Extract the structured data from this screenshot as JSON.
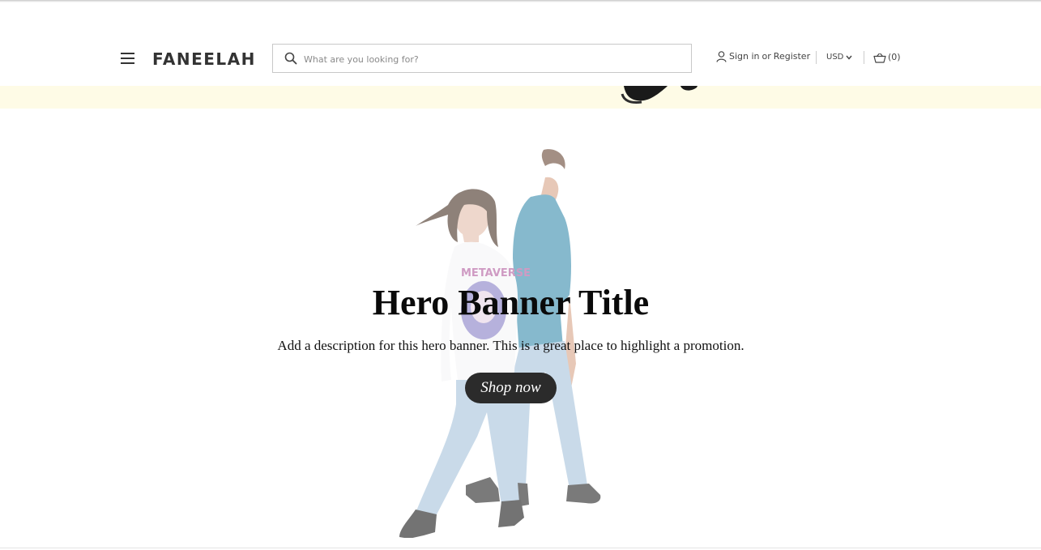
{
  "header": {
    "brand": "FANEELAH",
    "search": {
      "placeholder": "What are you looking for?",
      "value": ""
    },
    "account": {
      "sign_in": "Sign in",
      "or": "or",
      "register": "Register"
    },
    "currency": "USD",
    "cart": {
      "label": "(0)",
      "count": 0
    }
  },
  "hero": {
    "title": "Hero Banner Title",
    "description": "Add a description for this hero banner. This is a great place to highlight a promotion.",
    "button_label": "Shop now",
    "sweater_text": "METAVERSE"
  },
  "colors": {
    "promo_strip_bg": "#fefbe6",
    "button_bg": "#2b2b2b",
    "sweater_blue": "#3d8fb0",
    "jeans": "#a9c5dc"
  },
  "icons": [
    "menu-icon",
    "search-icon",
    "user-icon",
    "chevron-down-icon",
    "basket-icon"
  ]
}
